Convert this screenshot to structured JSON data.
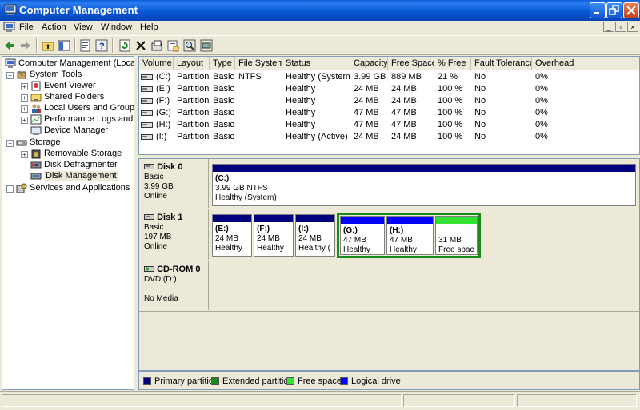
{
  "window": {
    "title": "Computer Management"
  },
  "menu": {
    "file": "File",
    "action": "Action",
    "view": "View",
    "window": "Window",
    "help": "Help"
  },
  "toolbar": {
    "icons": [
      "back-arrow-icon",
      "forward-arrow-icon",
      "up-folder-icon",
      "show-hide-tree-icon",
      "properties-icon",
      "help-icon",
      "refresh-icon",
      "delete-icon",
      "properties-sheet-icon",
      "search-icon",
      "drive-settings-icon"
    ]
  },
  "tree": {
    "root": "Computer Management (Local)",
    "system_tools": "System Tools",
    "event_viewer": "Event Viewer",
    "shared_folders": "Shared Folders",
    "local_users": "Local Users and Groups",
    "performance": "Performance Logs and Alerts",
    "device_manager": "Device Manager",
    "storage": "Storage",
    "removable": "Removable Storage",
    "defrag": "Disk Defragmenter",
    "disk_mgmt": "Disk Management",
    "services": "Services and Applications"
  },
  "volume_list": {
    "columns": [
      "Volume",
      "Layout",
      "Type",
      "File System",
      "Status",
      "Capacity",
      "Free Space",
      "% Free",
      "Fault Tolerance",
      "Overhead"
    ],
    "rows": [
      [
        "(C:)",
        "Partition",
        "Basic",
        "NTFS",
        "Healthy (System)",
        "3.99 GB",
        "889 MB",
        "21 %",
        "No",
        "0%"
      ],
      [
        "(E:)",
        "Partition",
        "Basic",
        "",
        "Healthy",
        "24 MB",
        "24 MB",
        "100 %",
        "No",
        "0%"
      ],
      [
        "(F:)",
        "Partition",
        "Basic",
        "",
        "Healthy",
        "24 MB",
        "24 MB",
        "100 %",
        "No",
        "0%"
      ],
      [
        "(G:)",
        "Partition",
        "Basic",
        "",
        "Healthy",
        "47 MB",
        "47 MB",
        "100 %",
        "No",
        "0%"
      ],
      [
        "(H:)",
        "Partition",
        "Basic",
        "",
        "Healthy",
        "47 MB",
        "47 MB",
        "100 %",
        "No",
        "0%"
      ],
      [
        "(I:)",
        "Partition",
        "Basic",
        "",
        "Healthy (Active)",
        "24 MB",
        "24 MB",
        "100 %",
        "No",
        "0%"
      ]
    ]
  },
  "disks": {
    "disk0": {
      "name": "Disk 0",
      "type": "Basic",
      "size": "3.99 GB",
      "status": "Online",
      "c": {
        "letter": "(C:)",
        "size": "3.99 GB NTFS",
        "status": "Healthy (System)"
      }
    },
    "disk1": {
      "name": "Disk 1",
      "type": "Basic",
      "size": "197 MB",
      "status": "Online",
      "e": {
        "letter": "(E:)",
        "size": "24 MB",
        "status": "Healthy"
      },
      "f": {
        "letter": "(F:)",
        "size": "24 MB",
        "status": "Healthy"
      },
      "i": {
        "letter": "(I:)",
        "size": "24 MB",
        "status": "Healthy ("
      },
      "g": {
        "letter": "(G:)",
        "size": "47 MB",
        "status": "Healthy"
      },
      "h": {
        "letter": "(H:)",
        "size": "47 MB",
        "status": "Healthy"
      },
      "free": {
        "size": "31 MB",
        "status": "Free spac"
      }
    },
    "cdrom0": {
      "name": "CD-ROM 0",
      "type": "DVD (D:)",
      "status": "No Media"
    }
  },
  "legend": {
    "primary": "Primary partition",
    "extended": "Extended partition",
    "free": "Free space",
    "logical": "Logical drive"
  },
  "colors": {
    "primary": "#00007f",
    "extended": "#1a8a1a",
    "free": "#33e233",
    "logical": "#0000ff"
  }
}
